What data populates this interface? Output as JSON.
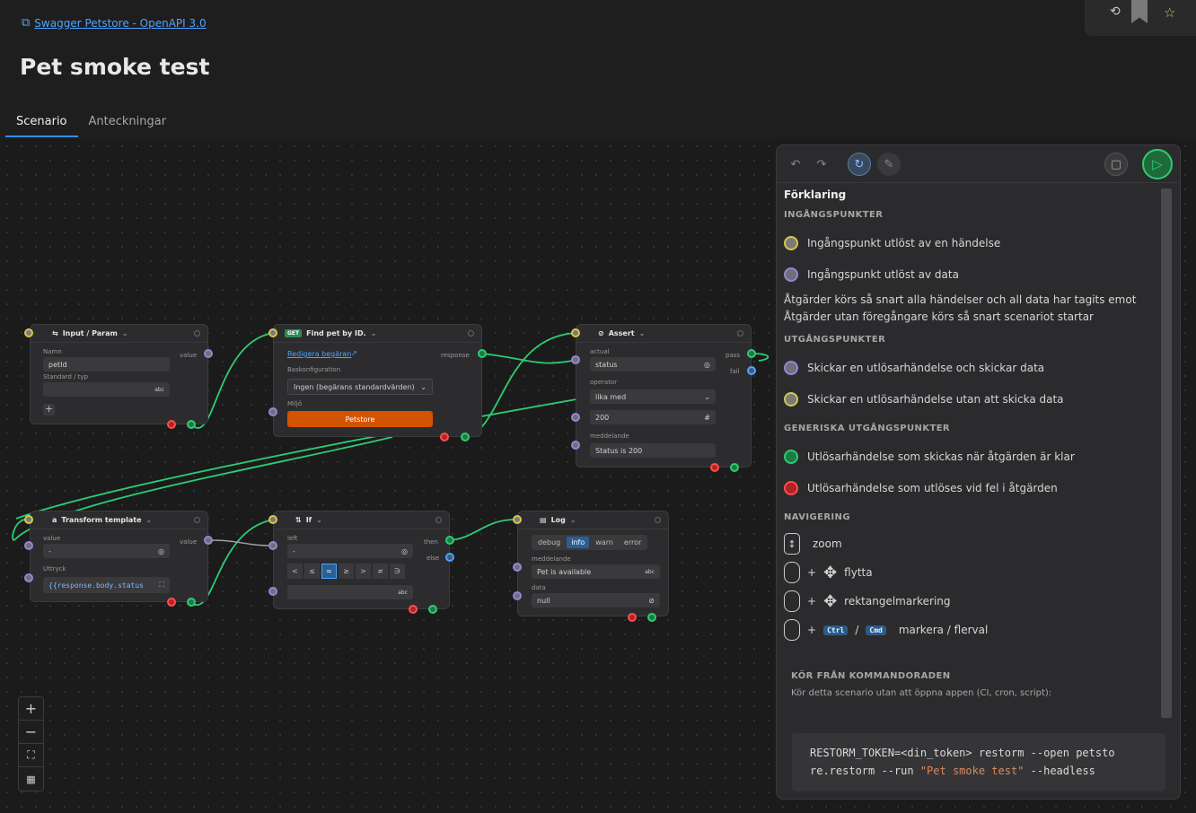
{
  "breadcrumb": {
    "icon": "api-icon",
    "label": "Swagger Petstore - OpenAPI 3.0"
  },
  "page": {
    "title": "Pet smoke test"
  },
  "tabs": [
    {
      "label": "Scenario",
      "active": true
    },
    {
      "label": "Anteckningar",
      "active": false
    }
  ],
  "nodes": {
    "input": {
      "title": "Input / Param",
      "name_label": "Namn",
      "name_value": "petId",
      "type_label": "Standard / typ",
      "type_suffix": "abc",
      "out_label": "value"
    },
    "find": {
      "badge": "GET",
      "title": "Find pet by ID.",
      "edit_link": "Redigera begäran",
      "base_label": "Baskonfiguration",
      "base_value": "Ingen (begärans standardvärden)",
      "env_label": "Miljö",
      "env_value": "Petstore",
      "out_label": "response"
    },
    "assert": {
      "title": "Assert",
      "actual_label": "actual",
      "actual_value": "status",
      "operator_label": "operator",
      "operator_value": "lika med",
      "expected_value": "200",
      "message_label": "meddelande",
      "message_value": "Status is 200",
      "pass_label": "pass",
      "fail_label": "fail"
    },
    "transform": {
      "title": "Transform template",
      "value_label": "value",
      "value_value": "-",
      "expr_label": "Uttryck",
      "expr_value": "{{response.body.status",
      "out_label": "value"
    },
    "if": {
      "title": "If",
      "left_label": "left",
      "left_value": "-",
      "ops": [
        "<",
        "≤",
        "=",
        "≥",
        ">",
        "≠",
        "∋"
      ],
      "right_suffix": "abc",
      "then_label": "then",
      "else_label": "else"
    },
    "log": {
      "title": "Log",
      "levels": [
        "debug",
        "info",
        "warn",
        "error"
      ],
      "message_label": "meddelande",
      "message_value": "Pet is available",
      "message_suffix": "abc",
      "data_label": "data",
      "data_value": "null"
    }
  },
  "legend": {
    "title": "Förklaring",
    "entry_header": "INGÅNGSPUNKTER",
    "entry_event": "Ingångspunkt utlöst av en händelse",
    "entry_data": "Ingångspunkt utlöst av data",
    "note1": "Åtgärder körs så snart alla händelser och all data har tagits emot",
    "note2": "Åtgärder utan föregångare körs så snart scenariot startar",
    "exit_header": "UTGÅNGSPUNKTER",
    "exit_data": "Skickar en utlösarhändelse och skickar data",
    "exit_event": "Skickar en utlösarhändelse utan att skicka data",
    "generic_header": "GENERISKA UTGÅNGSPUNKTER",
    "generic_ok": "Utlösarhändelse som skickas när åtgärden är klar",
    "generic_err": "Utlösarhändelse som utlöses vid fel i åtgärden",
    "nav_header": "NAVIGERING",
    "nav_zoom": "zoom",
    "nav_move": "flytta",
    "nav_rect": "rektangelmarkering",
    "nav_select": "markera / flerval",
    "kbd_ctrl": "Ctrl",
    "kbd_cmd": "Cmd",
    "plus": "+",
    "slash": "/",
    "cli_header": "KÖR FRÅN KOMMANDORADEN",
    "cli_desc": "Kör detta scenario utan att öppna appen (CI, cron, script):",
    "cli_line1": "RESTORM_TOKEN=<din_token> restorm --open petsto",
    "cli_line2_a": "re.restorm --run ",
    "cli_line2_b": "\"Pet smoke test\"",
    "cli_line2_c": " --headless"
  },
  "colors": {
    "accent": "#2f8fff",
    "ok": "#2ecc71",
    "error": "#ff4d4d",
    "event": "#d7c64a",
    "data": "#9b82d6",
    "env": "#d35400"
  }
}
